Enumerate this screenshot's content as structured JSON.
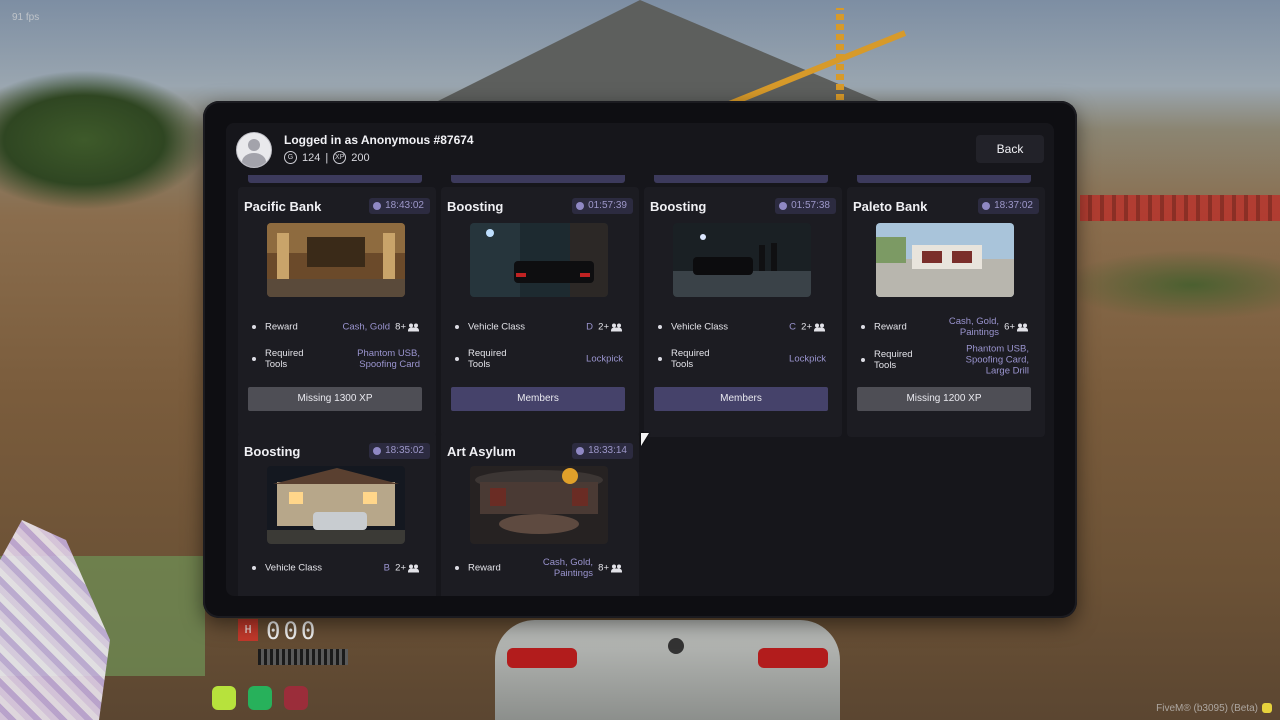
{
  "overlay": {
    "fps": "91 fps",
    "watermark": "FiveM® (b3095) (Beta)",
    "hud_gear": "H",
    "hud_speed": "000"
  },
  "header": {
    "user_title": "Logged in as Anonymous #87674",
    "stat1": "124",
    "separator": "|",
    "stat2": "200",
    "back_label": "Back"
  },
  "cards": [
    {
      "title": "Pacific Bank",
      "timer": "18:43:02",
      "row1_label": "Reward",
      "row1_value": "Cash, Gold",
      "row1_members": "8+",
      "row2_label": "Required Tools",
      "row2_value": "Phantom USB, Spoofing Card",
      "action": "Missing 1300 XP",
      "action_type": "missing"
    },
    {
      "title": "Boosting",
      "timer": "01:57:39",
      "row1_label": "Vehicle Class",
      "row1_value": "D",
      "row1_members": "2+",
      "row2_label": "Required Tools",
      "row2_value": "Lockpick",
      "action": "Members",
      "action_type": "members"
    },
    {
      "title": "Boosting",
      "timer": "01:57:38",
      "row1_label": "Vehicle Class",
      "row1_value": "C",
      "row1_members": "2+",
      "row2_label": "Required Tools",
      "row2_value": "Lockpick",
      "action": "Members",
      "action_type": "members"
    },
    {
      "title": "Paleto Bank",
      "timer": "18:37:02",
      "row1_label": "Reward",
      "row1_value": "Cash, Gold, Paintings",
      "row1_members": "6+",
      "row2_label": "Required Tools",
      "row2_value": "Phantom USB, Spoofing Card, Large Drill",
      "action": "Missing 1200 XP",
      "action_type": "missing"
    },
    {
      "title": "Boosting",
      "timer": "18:35:02",
      "row1_label": "Vehicle Class",
      "row1_value": "B",
      "row1_members": "2+"
    },
    {
      "title": "Art Asylum",
      "timer": "18:33:14",
      "row1_label": "Reward",
      "row1_value": "Cash, Gold, Paintings",
      "row1_members": "8+"
    }
  ],
  "colors": {
    "accent": "#45426a",
    "timer_text": "#9d97c9",
    "missing_bg": "#4e4e55",
    "panel_bg": "#16161b"
  }
}
